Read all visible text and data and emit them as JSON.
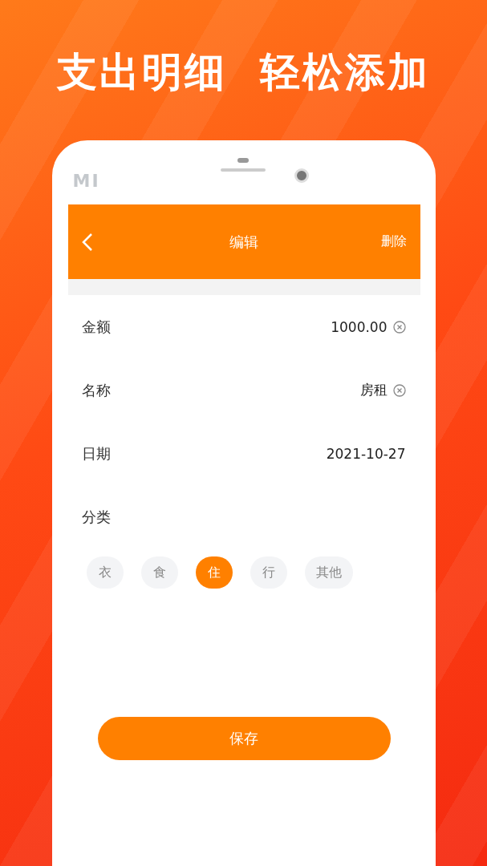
{
  "headline": "支出明细  轻松添加",
  "phone": {
    "brand": "MI"
  },
  "header": {
    "title": "编辑",
    "action": "删除"
  },
  "fields": [
    {
      "label": "金额",
      "value": "1000.00",
      "clearable": true
    },
    {
      "label": "名称",
      "value": "房租",
      "clearable": true
    },
    {
      "label": "日期",
      "value": "2021-10-27",
      "clearable": false
    }
  ],
  "category": {
    "label": "分类",
    "options": [
      {
        "label": "衣",
        "selected": false
      },
      {
        "label": "食",
        "selected": false
      },
      {
        "label": "住",
        "selected": true
      },
      {
        "label": "行",
        "selected": false
      },
      {
        "label": "其他",
        "selected": false
      }
    ]
  },
  "save_button": "保存"
}
